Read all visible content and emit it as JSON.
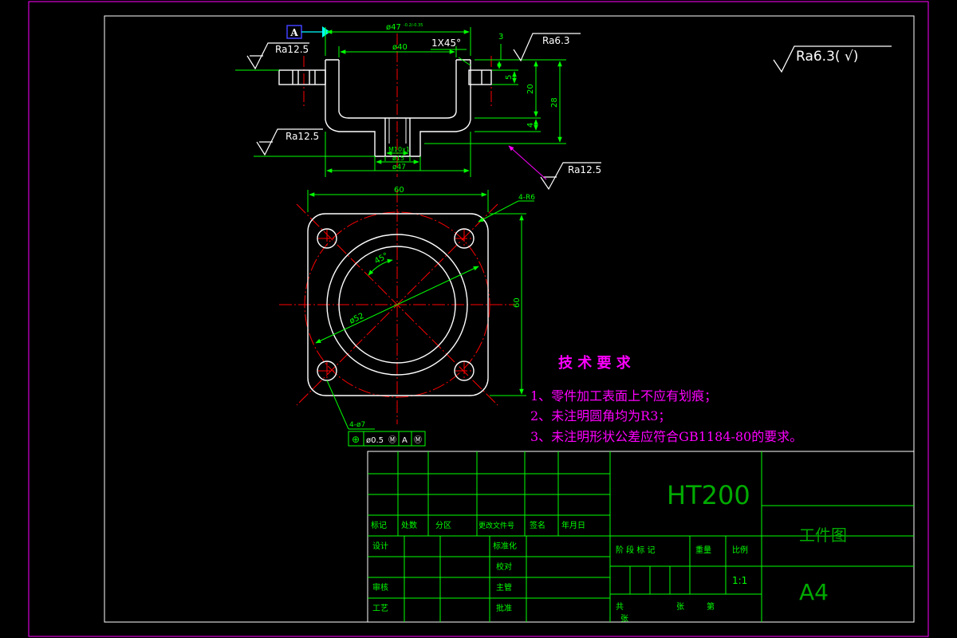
{
  "colors": {
    "background": "#000000",
    "frame": "#ff00ff",
    "outline": "#ffffff",
    "dimension": "#00ff00",
    "centerline": "#ff0000",
    "note": "#ff00ff",
    "datum": "#00ffff"
  },
  "datum_label": "A",
  "surface_finish_default": "Ra6.3( √)",
  "section_view": {
    "dims": {
      "top_width": "ø47",
      "top_width_tol": "-0.2/-0.35",
      "inner_width": "ø40",
      "chamfer": "1X45°",
      "top_depth": "3",
      "flange_thk": "5",
      "cavity_depth": "20",
      "overall_height": "28",
      "bottom_thk": "4",
      "thread": "M10x1",
      "boss_dia": "ø15",
      "bottom_dia": "ø47"
    },
    "roughness": {
      "top_right": "Ra6.3",
      "top_left": "Ra12.5",
      "mid_left": "Ra12.5",
      "bottom_right": "Ra12.5"
    }
  },
  "plan_view": {
    "dims": {
      "width": "60",
      "height": "60",
      "corner_radius": "4-R6",
      "pitch_circle": "ø52",
      "angle": "45°",
      "holes": "4-ø7"
    },
    "tolerance_frame": {
      "symbol": "⊕",
      "value": "ø0.5",
      "modifier": "Ⓜ",
      "datum": "A",
      "datum_modifier": "Ⓜ"
    }
  },
  "notes": {
    "title": "技 术 要 求",
    "items": [
      "1、零件加工表面上不应有划痕；",
      "2、未注明圆角均为R3；",
      "3、未注明形状公差应符合GB1184-80的要求。"
    ]
  },
  "title_block": {
    "material": "HT200",
    "drawing_title": "工件图",
    "sheet_size": "A4",
    "scale": "1:1",
    "labels": {
      "mark": "标记",
      "count": "处数",
      "zone": "分区",
      "doc_no": "更改文件号",
      "signature": "签名",
      "date": "年月日",
      "design": "设计",
      "standardization": "标准化",
      "proofread": "校对",
      "review": "审核",
      "process": "工艺",
      "supervisor": "主管",
      "approve": "批准",
      "stage_mark": "阶 段 标 记",
      "weight": "重量",
      "ratio": "比例",
      "total": "共",
      "sheets": "张",
      "page": "第",
      "sheet": "张"
    }
  }
}
